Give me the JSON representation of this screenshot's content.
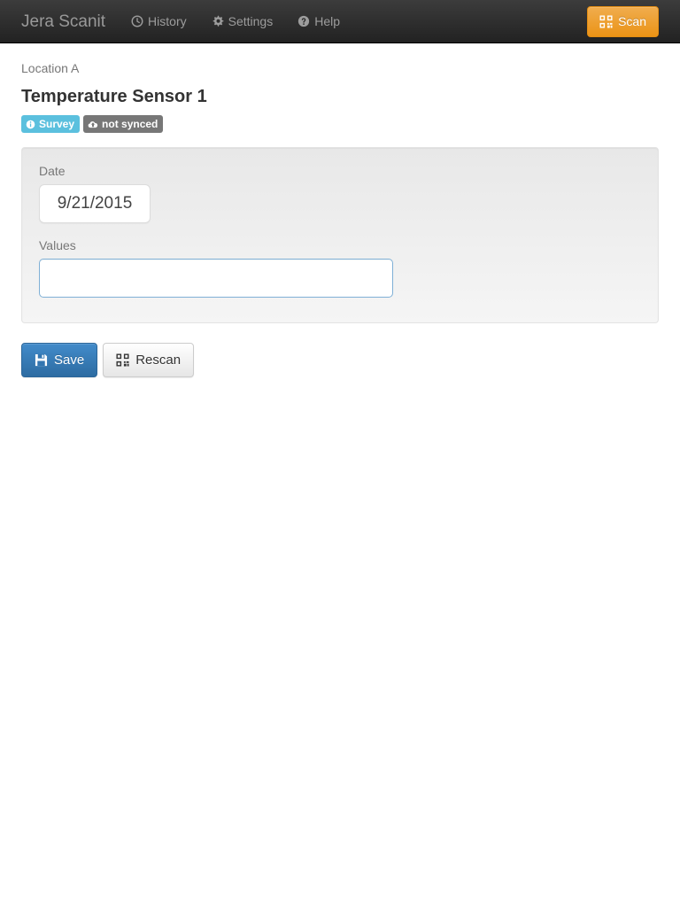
{
  "navbar": {
    "brand": "Jera Scanit",
    "items": [
      {
        "label": "History",
        "icon": "clock-icon"
      },
      {
        "label": "Settings",
        "icon": "gear-icon"
      },
      {
        "label": "Help",
        "icon": "question-circle-icon"
      }
    ],
    "scan_button": {
      "label": "Scan",
      "icon": "qrcode-icon",
      "color": "#ed9c28"
    }
  },
  "page": {
    "breadcrumb": "Location A",
    "title": "Temperature Sensor 1",
    "badges": [
      {
        "label": "Survey",
        "icon": "info-circle-icon",
        "color": "#5bc0de"
      },
      {
        "label": "not synced",
        "icon": "cloud-upload-icon",
        "color": "#777777"
      }
    ]
  },
  "form": {
    "date": {
      "label": "Date",
      "value": "9/21/2015",
      "placeholder": ""
    },
    "values": {
      "label": "Values",
      "value": "",
      "placeholder": ""
    }
  },
  "actions": {
    "save": {
      "label": "Save",
      "icon": "save-icon",
      "color": "#3276b1"
    },
    "rescan": {
      "label": "Rescan",
      "icon": "qrcode-icon",
      "color": "#f5f5f5"
    }
  }
}
